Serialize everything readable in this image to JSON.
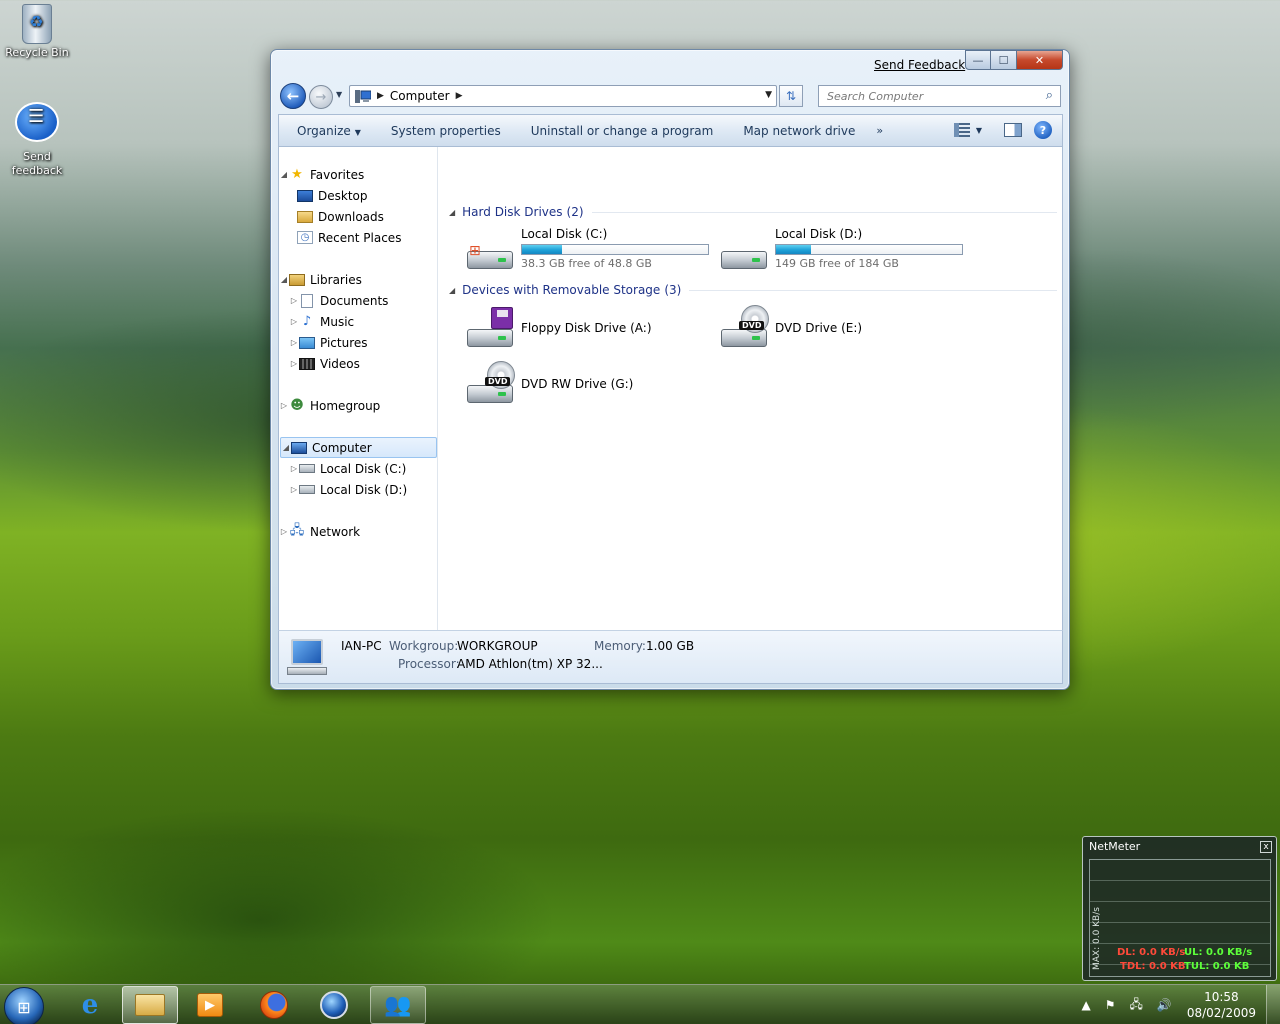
{
  "desktop": {
    "icons": [
      {
        "label": "Recycle Bin"
      },
      {
        "label": "Send feedback"
      }
    ]
  },
  "window": {
    "send_feedback": "Send Feedback",
    "caption": {
      "minimize": "—",
      "maximize": "☐",
      "close": "✕"
    },
    "address": {
      "crumb": "Computer"
    },
    "search": {
      "placeholder": "Search Computer"
    },
    "toolbar": {
      "items": [
        "Organize",
        "System properties",
        "Uninstall or change a program",
        "Map network drive"
      ],
      "more": "»"
    },
    "nav": {
      "favorites": {
        "label": "Favorites",
        "items": [
          "Desktop",
          "Downloads",
          "Recent Places"
        ]
      },
      "libraries": {
        "label": "Libraries",
        "items": [
          "Documents",
          "Music",
          "Pictures",
          "Videos"
        ]
      },
      "homegroup": "Homegroup",
      "computer": {
        "label": "Computer",
        "items": [
          "Local Disk (C:)",
          "Local Disk (D:)"
        ]
      },
      "network": "Network"
    },
    "groups": {
      "hdd": {
        "title": "Hard Disk Drives",
        "count": "(2)"
      },
      "removable": {
        "title": "Devices with Removable Storage",
        "count": "(3)"
      }
    },
    "drives": {
      "c": {
        "name": "Local Disk (C:)",
        "free": "38.3 GB free of 48.8 GB",
        "used_fraction": 0.215
      },
      "d": {
        "name": "Local Disk (D:)",
        "free": "149 GB free of 184 GB",
        "used_fraction": 0.19
      },
      "a": {
        "name": "Floppy Disk Drive (A:)"
      },
      "e": {
        "name": "DVD Drive (E:)",
        "badge": "DVD"
      },
      "g": {
        "name": "DVD RW Drive (G:)",
        "badge": "DVD"
      }
    },
    "details": {
      "pc_name": "IAN-PC",
      "workgroup_label": "Workgroup:",
      "workgroup": "WORKGROUP",
      "memory_label": "Memory:",
      "memory": "1.00 GB",
      "processor_label": "Processor:",
      "processor": "AMD Athlon(tm) XP 32..."
    }
  },
  "netmeter": {
    "title": "NetMeter",
    "close": "x",
    "axis": "MAX: 0.0 KB/s",
    "dl": "DL: 0.0 KB/s",
    "ul": "UL: 0.0 KB/s",
    "tdl": "TDL: 0.0 KB",
    "tul": "TUL: 0.0 KB"
  },
  "taskbar": {
    "clock_time": "10:58",
    "clock_date": "08/02/2009"
  },
  "colors": {
    "accent": "#1e3287",
    "bar_fill": "#1ea1d8",
    "nm_red": "#ff4a3a",
    "nm_green": "#5dff3a"
  }
}
